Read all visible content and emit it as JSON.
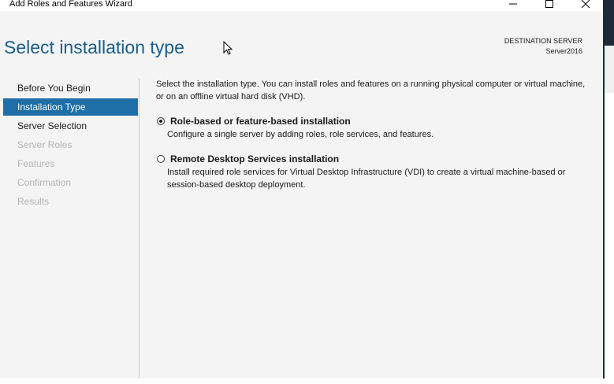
{
  "window": {
    "title": "Add Roles and Features Wizard",
    "controls": {
      "minimize_icon": "minimize-icon",
      "maximize_icon": "maximize-icon",
      "close_icon": "close-icon"
    }
  },
  "header": {
    "page_title": "Select installation type",
    "destination_label": "DESTINATION SERVER",
    "destination_value": "Server2016"
  },
  "nav": {
    "items": [
      {
        "label": "Before You Begin",
        "state": "enabled"
      },
      {
        "label": "Installation Type",
        "state": "active"
      },
      {
        "label": "Server Selection",
        "state": "enabled"
      },
      {
        "label": "Server Roles",
        "state": "disabled"
      },
      {
        "label": "Features",
        "state": "disabled"
      },
      {
        "label": "Confirmation",
        "state": "disabled"
      },
      {
        "label": "Results",
        "state": "disabled"
      }
    ]
  },
  "content": {
    "intro": "Select the installation type. You can install roles and features on a running physical computer or virtual machine, or on an offline virtual hard disk (VHD).",
    "options": [
      {
        "title": "Role-based or feature-based installation",
        "description": "Configure a single server by adding roles, role services, and features.",
        "selected": true
      },
      {
        "title": "Remote Desktop Services installation",
        "description": "Install required role services for Virtual Desktop Infrastructure (VDI) to create a virtual machine-based or session-based desktop deployment.",
        "selected": false
      }
    ]
  },
  "colors": {
    "accent": "#1e6ea7",
    "title_blue": "#1c5e8a",
    "panel_bg": "#f4f4f4",
    "disabled_text": "#b4b4b4"
  }
}
